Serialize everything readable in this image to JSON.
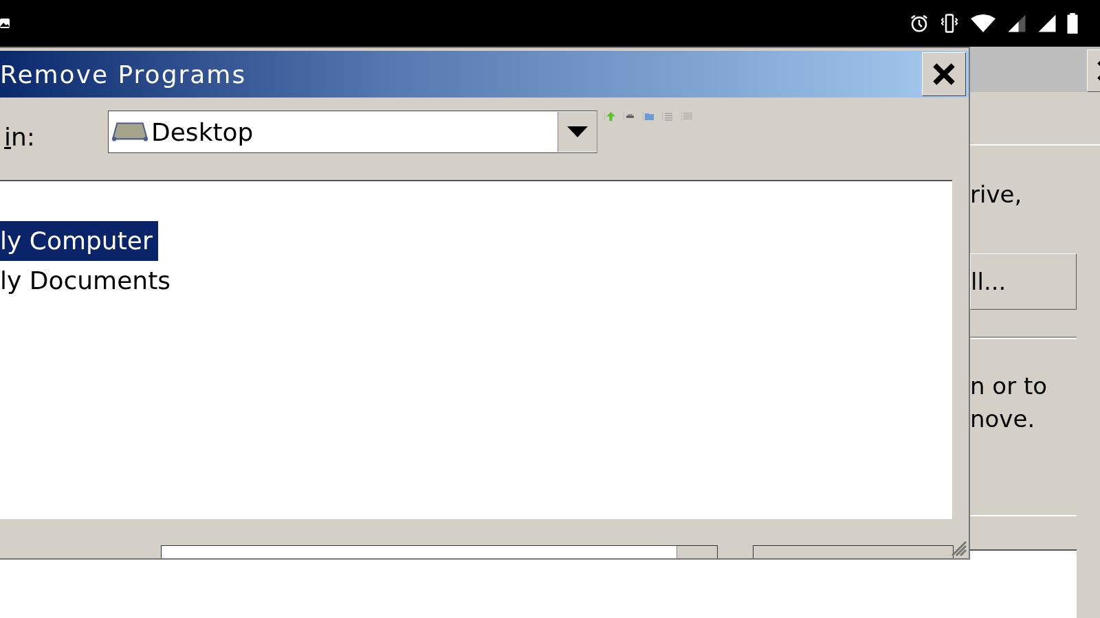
{
  "dialog": {
    "title": "Remove Programs",
    "look_in": {
      "label": "in:",
      "value": "Desktop"
    },
    "files": [
      {
        "name": "ly Computer",
        "selected": true
      },
      {
        "name": "ly Documents",
        "selected": false
      }
    ]
  },
  "background_window": {
    "line_1": "rive,",
    "button": "ll...",
    "line_2": "n or to",
    "line_3": "nove."
  }
}
